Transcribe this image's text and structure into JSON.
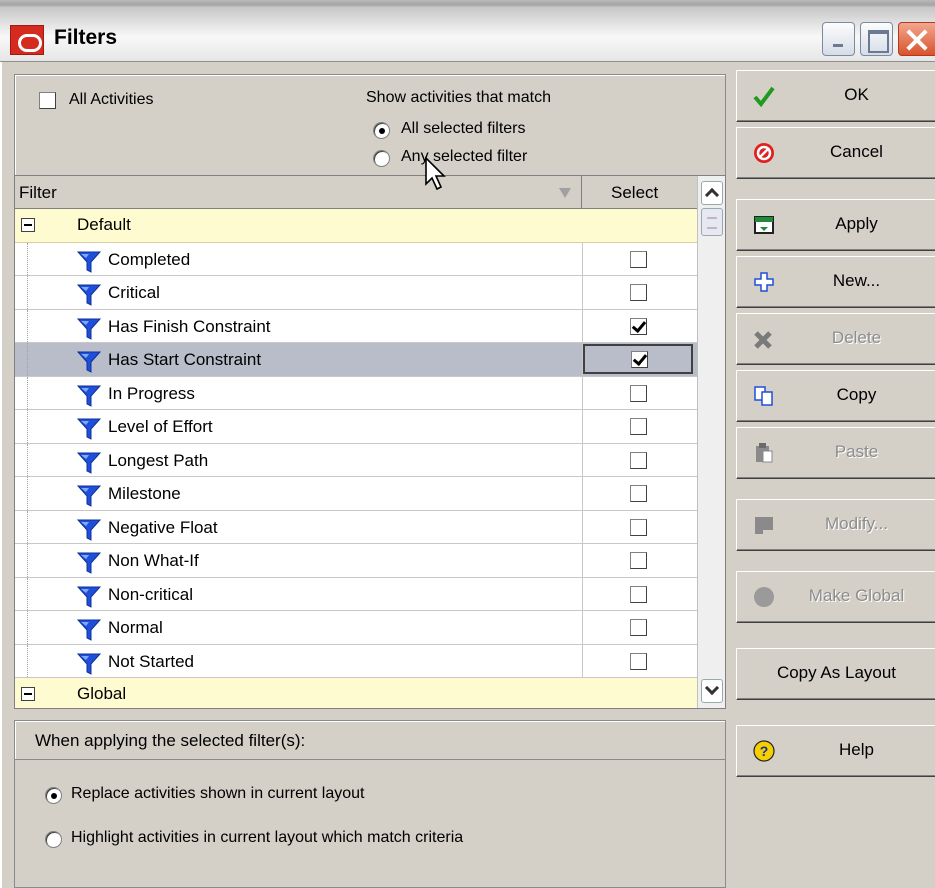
{
  "window": {
    "title": "Filters"
  },
  "top": {
    "all_activities": "All Activities",
    "match_caption": "Show activities that match",
    "match_all": "All selected filters",
    "match_any": "Any selected filter"
  },
  "table": {
    "col_filter": "Filter",
    "col_select": "Select",
    "group_default": "Default",
    "group_global": "Global",
    "rows": [
      {
        "label": "Completed",
        "checked": false
      },
      {
        "label": "Critical",
        "checked": false
      },
      {
        "label": "Has Finish Constraint",
        "checked": true
      },
      {
        "label": "Has Start Constraint",
        "checked": true,
        "selected": true
      },
      {
        "label": "In Progress",
        "checked": false
      },
      {
        "label": "Level of Effort",
        "checked": false
      },
      {
        "label": "Longest Path",
        "checked": false
      },
      {
        "label": "Milestone",
        "checked": false
      },
      {
        "label": "Negative Float",
        "checked": false
      },
      {
        "label": "Non What-If",
        "checked": false
      },
      {
        "label": "Non-critical",
        "checked": false
      },
      {
        "label": "Normal",
        "checked": false
      },
      {
        "label": "Not Started",
        "checked": false
      }
    ]
  },
  "apply_options": {
    "caption": "When applying the selected filter(s):",
    "replace": "Replace activities shown in current layout",
    "highlight": "Highlight activities in current layout which match criteria"
  },
  "buttons": {
    "ok": "OK",
    "cancel": "Cancel",
    "apply": "Apply",
    "new": "New...",
    "delete": "Delete",
    "copy": "Copy",
    "paste": "Paste",
    "modify": "Modify...",
    "make_global": "Make Global",
    "copy_as_layout": "Copy As Layout",
    "help": "Help"
  },
  "colors": {
    "filter_icon": "#1f4fd8",
    "group_row": "#fffbd0",
    "selected_row": "#b8bdc9",
    "dialog": "#d4d0c8"
  }
}
